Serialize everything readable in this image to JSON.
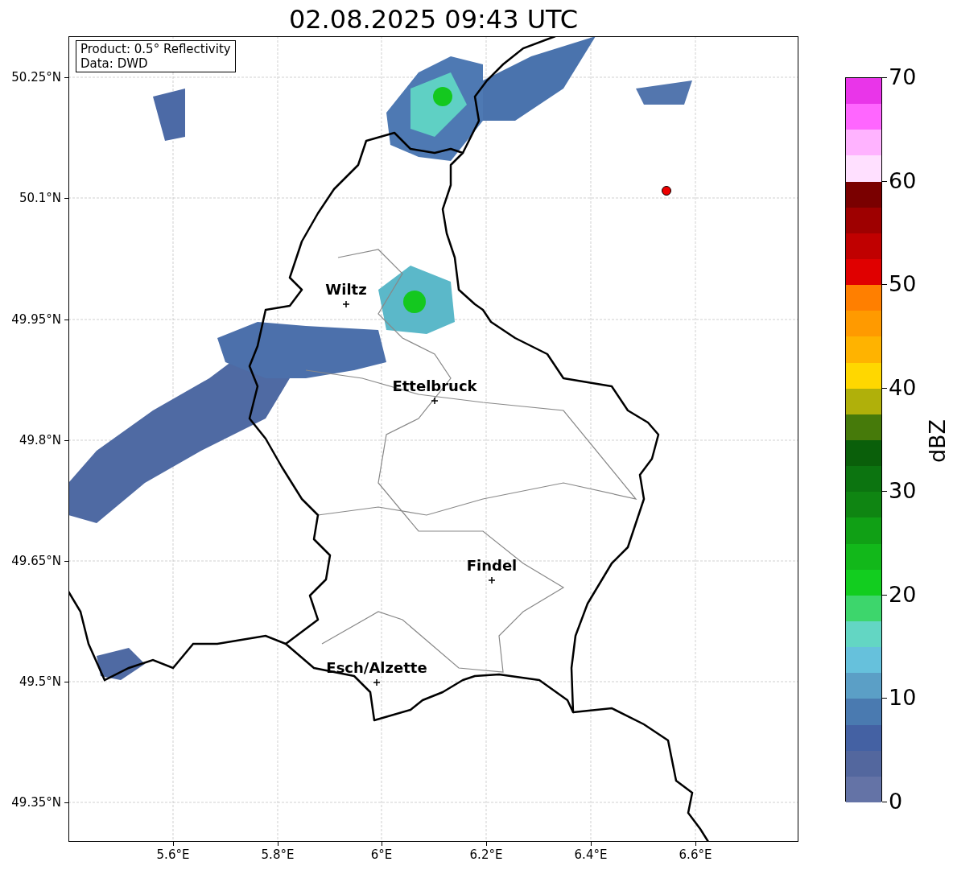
{
  "title": "02.08.2025 09:43 UTC",
  "legend": [
    "Product: 0.5° Reflectivity",
    "Data: DWD"
  ],
  "map": {
    "yticks": [
      "50.25°N",
      "50.1°N",
      "49.95°N",
      "49.8°N",
      "49.65°N",
      "49.5°N",
      "49.35°N"
    ],
    "xticks": [
      "5.6°E",
      "5.8°E",
      "6°E",
      "6.2°E",
      "6.4°E",
      "6.6°E"
    ],
    "cities": [
      {
        "name": "Wiltz"
      },
      {
        "name": "Ettelbruck"
      },
      {
        "name": "Findel"
      },
      {
        "name": "Esch/Alzette"
      }
    ],
    "marker": {
      "color": "#ee0000"
    }
  },
  "colorbar": {
    "label": "dBZ",
    "ticks": [
      "70",
      "60",
      "50",
      "40",
      "30",
      "20",
      "10",
      "0"
    ],
    "bands": [
      {
        "color": "#e935e9"
      },
      {
        "color": "#ff66ff"
      },
      {
        "color": "#ffb3ff"
      },
      {
        "color": "#ffe0ff"
      },
      {
        "color": "#7a0000"
      },
      {
        "color": "#9e0000"
      },
      {
        "color": "#c00000"
      },
      {
        "color": "#e00000"
      },
      {
        "color": "#ff7f00"
      },
      {
        "color": "#ff9a00"
      },
      {
        "color": "#ffb300"
      },
      {
        "color": "#ffd700"
      },
      {
        "color": "#b0b00a"
      },
      {
        "color": "#467a0a"
      },
      {
        "color": "#0a5f0a"
      },
      {
        "color": "#0c7410"
      },
      {
        "color": "#0f8512"
      },
      {
        "color": "#10a015"
      },
      {
        "color": "#12b81a"
      },
      {
        "color": "#12cd1f"
      },
      {
        "color": "#3dd66c"
      },
      {
        "color": "#63d6c3"
      },
      {
        "color": "#66c1dc"
      },
      {
        "color": "#5b9fc6"
      },
      {
        "color": "#4a7ab0"
      },
      {
        "color": "#4461a3"
      },
      {
        "color": "#53679e"
      },
      {
        "color": "#6473a6"
      }
    ]
  }
}
